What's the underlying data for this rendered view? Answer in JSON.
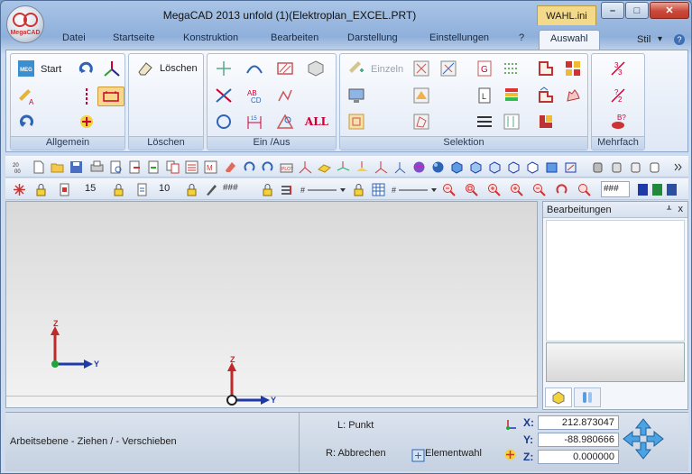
{
  "window": {
    "title": "MegaCAD 2013 unfold (1)(Elektroplan_EXCEL.PRT)",
    "context_tab": "WAHL.ini",
    "logo_text": "MegaCAD",
    "controls": {
      "minimize": "–",
      "maximize": "□",
      "close": "✕"
    }
  },
  "menu": {
    "tabs": [
      "Datei",
      "Startseite",
      "Konstruktion",
      "Bearbeiten",
      "Darstellung",
      "Einstellungen",
      "?",
      "Auswahl"
    ],
    "active_tab": "Auswahl",
    "style_label": "Stil",
    "style_arrow": "▾",
    "help_icon": "?"
  },
  "ribbon": {
    "groups": {
      "allgemein": "Allgemein",
      "loeschen": "Löschen",
      "ein_aus": "Ein /Aus",
      "selektion": "Selektion",
      "mehrfach": "Mehrfach"
    },
    "start_label": "Start",
    "loeschen_button": "Löschen",
    "einzeln_label": "Einzeln",
    "all_label": "ALL"
  },
  "toolbar2": {
    "pen_value": "15",
    "line_value": "10",
    "hatch_text_1": "###",
    "hatch_text_2": "###",
    "hatch_text_3": "###"
  },
  "canvas": {
    "axis_z": "Z",
    "axis_y": "Y"
  },
  "panel": {
    "title": "Bearbeitungen",
    "pin": "ᚆ",
    "close": "x"
  },
  "status": {
    "left_text": "Arbeitsebene - Ziehen / - Verschieben",
    "l_hint": "L: Punkt",
    "r_hint": "R: Abbrechen",
    "element_choice": "Elementwahl",
    "coords": {
      "x_label": "X:",
      "y_label": "Y:",
      "z_label": "Z:",
      "x": "212.873047",
      "y": "-88.980666",
      "z": "0.000000"
    }
  },
  "colors": {
    "accent": "#3d6fb6",
    "axis_z": "#c0282a",
    "axis_y": "#1e3aa8",
    "selected": "#f8d68a"
  }
}
